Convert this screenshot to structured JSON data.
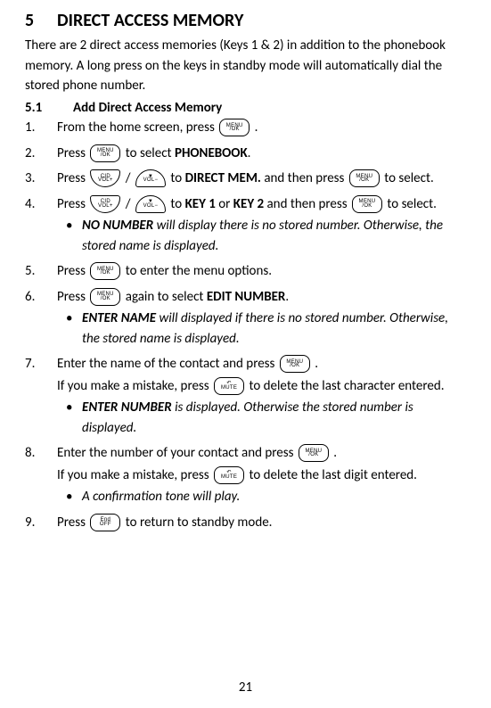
{
  "section": {
    "number": "5",
    "title": "DIRECT ACCESS MEMORY"
  },
  "intro": "There are 2 direct access memories (Keys 1 & 2) in addition to the phonebook memory. A long press on the keys in standby mode will automatically dial the stored phone number.",
  "subsection": {
    "number": "5.1",
    "title": "Add Direct Access Memory"
  },
  "keys": {
    "menuok_top": "MENU",
    "menuok_bot": "/OK",
    "up_top": "CID",
    "up_bot": "VOL+",
    "down_top": "▼",
    "down_bot": "VOL−",
    "mute_top": "↶",
    "mute_bot": "MUTE",
    "off_top": "End",
    "off_bot": "OFF"
  },
  "steps": {
    "s1": {
      "n": "1.",
      "a": "From the home screen, press ",
      "b": "."
    },
    "s2": {
      "n": "2.",
      "a": "Press ",
      "b": " to select ",
      "c": "PHONEBOOK",
      "d": "."
    },
    "s3": {
      "n": "3.",
      "a": "Press ",
      "slash": " / ",
      "b": " to ",
      "c": "DIRECT MEM.",
      "d": " and then press ",
      "e": " to select."
    },
    "s4": {
      "n": "4.",
      "a": "Press ",
      "slash": " / ",
      "b": " to ",
      "c": "KEY 1",
      "d": " or ",
      "e": "KEY 2",
      "f": " and then press ",
      "g": " to select."
    },
    "s4sub": {
      "a": "NO NUMBER",
      "b": " will display there is no stored number. Otherwise, the stored name is displayed."
    },
    "s5": {
      "n": "5.",
      "a": " Press ",
      "b": " to enter the menu options."
    },
    "s6": {
      "n": "6.",
      "a": " Press ",
      "b": " again to select ",
      "c": "EDIT NUMBER",
      "d": "."
    },
    "s6sub": {
      "a": "ENTER NAME",
      "b": " will displayed if there is no stored number. Otherwise, the stored name is displayed."
    },
    "s7": {
      "n": "7.",
      "a": "Enter the name of the contact and press ",
      "b": ".",
      "c": "If you make a mistake, press ",
      "d": " to delete the last character entered."
    },
    "s7sub": {
      "a": "ENTER NUMBER",
      "b": " is displayed. Otherwise the stored number is displayed."
    },
    "s8": {
      "n": "8.",
      "a": "Enter the number of your contact and press ",
      "b": " .",
      "c": "If you make a mistake, press ",
      "d": " to delete the last digit entered."
    },
    "s8sub": {
      "a": "A confirmation tone will play."
    },
    "s9": {
      "n": "9.",
      "a": "Press ",
      "b": " to return to standby mode."
    }
  },
  "page_number": "21"
}
